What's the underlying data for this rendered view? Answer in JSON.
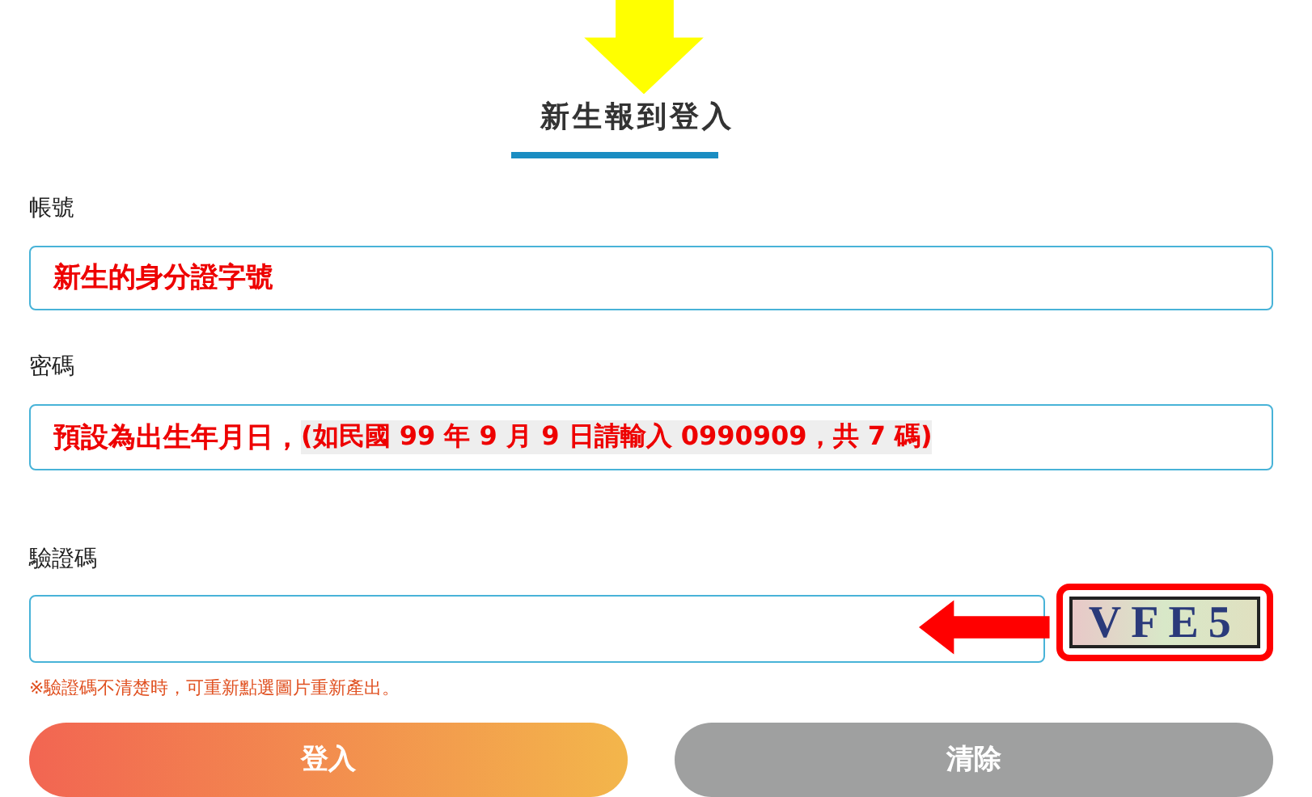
{
  "title": "新生報到登入",
  "fields": [
    {
      "kind": "text",
      "label": "帳號",
      "value": "新生的身分證字號"
    },
    {
      "kind": "text",
      "label": "密碼",
      "value": "預設為出生年月日，",
      "value_highlight": "(如民國 99 年 9 月 9 日請輸入 0990909，共 7 碼)"
    },
    {
      "kind": "captcha",
      "label": "驗證碼",
      "captcha": "VFE5"
    }
  ],
  "note": "※驗證碼不清楚時，可重新點選圖片重新產出。",
  "buttons": [
    {
      "label": "登入",
      "kind": "primary"
    },
    {
      "label": "清除",
      "kind": "secondary"
    }
  ]
}
